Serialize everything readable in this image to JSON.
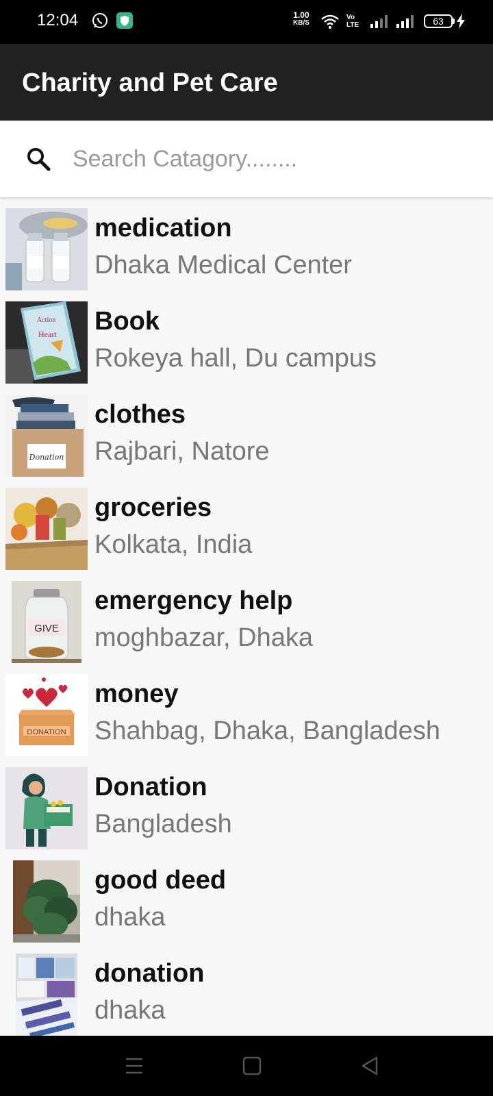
{
  "status_bar": {
    "time": "12:04",
    "net_speed": "1.00",
    "net_unit": "KB/S",
    "volte": "Vo LTE",
    "battery": "63",
    "icons": [
      "whatsapp-icon",
      "shield-app-icon",
      "wifi-icon",
      "volte-icon",
      "signal-icon",
      "signal-icon",
      "battery-icon",
      "charging-icon"
    ]
  },
  "app_bar": {
    "title": "Charity and Pet Care"
  },
  "search": {
    "placeholder": "Search Catagory........",
    "value": "",
    "icon": "search-icon"
  },
  "items": [
    {
      "title": "medication",
      "subtitle": "Dhaka Medical Center",
      "image": "medicine-vials"
    },
    {
      "title": "Book",
      "subtitle": "Rokeya hall, Du campus",
      "image": "book"
    },
    {
      "title": "clothes",
      "subtitle": "Rajbari, Natore",
      "image": "clothes-donation-box",
      "image_text": "Donation"
    },
    {
      "title": "groceries",
      "subtitle": "Kolkata, India",
      "image": "groceries-box"
    },
    {
      "title": "emergency help",
      "subtitle": "moghbazar, Dhaka",
      "image": "give-jar",
      "image_text": "GIVE"
    },
    {
      "title": "money",
      "subtitle": "Shahbag, Dhaka, Bangladesh",
      "image": "donation-box-hearts",
      "image_text": "DONATION"
    },
    {
      "title": "Donation",
      "subtitle": "Bangladesh",
      "image": "woman-holding-donation-box"
    },
    {
      "title": "good deed",
      "subtitle": "dhaka",
      "image": "house-plant"
    },
    {
      "title": "donation",
      "subtitle": "dhaka",
      "image": "donated-supplies"
    }
  ],
  "colors": {
    "app_bar": "#212121",
    "status_bar": "#000000",
    "background": "#f7f7f7",
    "title_text": "#111111",
    "subtitle_text": "#777777"
  }
}
